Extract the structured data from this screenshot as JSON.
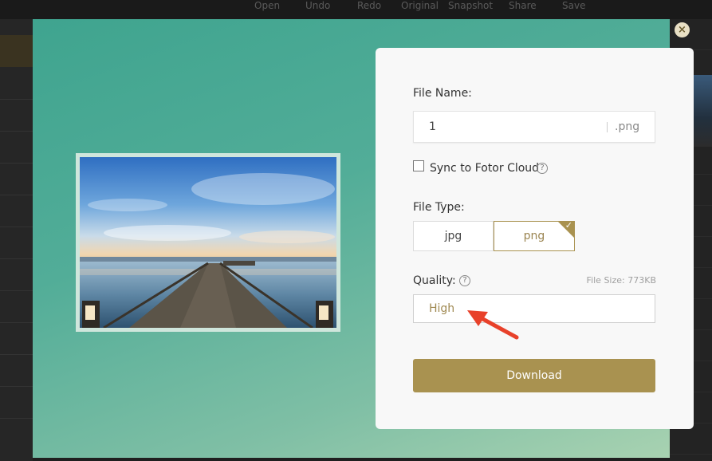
{
  "background_menu": [
    "Open",
    "Undo",
    "Redo",
    "Original",
    "Snapshot",
    "Share",
    "Save"
  ],
  "dialog": {
    "close_icon": "×",
    "file_name_label": "File Name:",
    "file_name_value": "1",
    "file_extension": ".png",
    "sync_label": "Sync to Fotor Cloud",
    "sync_checked": false,
    "help_glyph": "?",
    "file_type_label": "File Type:",
    "file_types": [
      "jpg",
      "png"
    ],
    "selected_file_type": "png",
    "check_glyph": "✓",
    "quality_label": "Quality:",
    "file_size": "File Size: 773KB",
    "quality_value": "High",
    "download_label": "Download"
  },
  "colors": {
    "accent": "#a99250",
    "modal_bg": "#52ad98",
    "arrow": "#e8412a"
  }
}
